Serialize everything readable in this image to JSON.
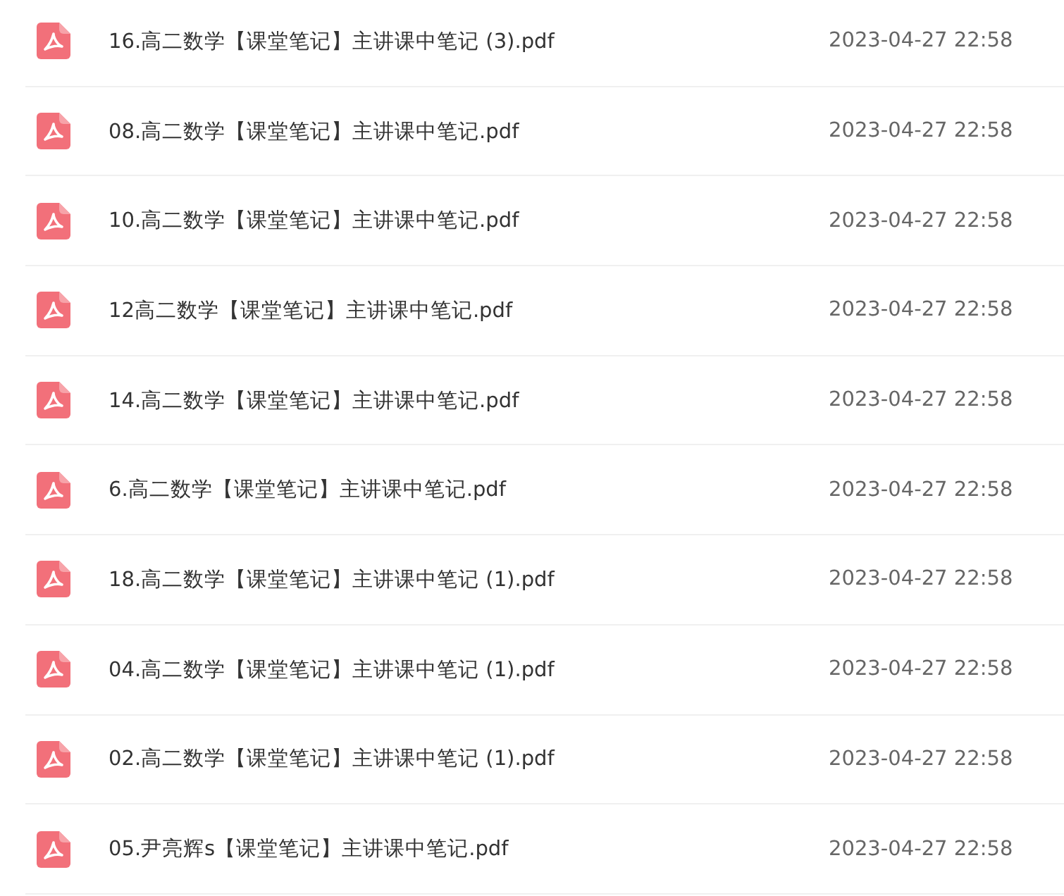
{
  "files": [
    {
      "name": "16.高二数学【课堂笔记】主讲课中笔记 (3).pdf",
      "date": "2023-04-27 22:58"
    },
    {
      "name": "08.高二数学【课堂笔记】主讲课中笔记.pdf",
      "date": "2023-04-27 22:58"
    },
    {
      "name": "10.高二数学【课堂笔记】主讲课中笔记.pdf",
      "date": "2023-04-27 22:58"
    },
    {
      "name": "12高二数学【课堂笔记】主讲课中笔记.pdf",
      "date": "2023-04-27 22:58"
    },
    {
      "name": "14.高二数学【课堂笔记】主讲课中笔记.pdf",
      "date": "2023-04-27 22:58"
    },
    {
      "name": "6.高二数学【课堂笔记】主讲课中笔记.pdf",
      "date": "2023-04-27 22:58"
    },
    {
      "name": "18.高二数学【课堂笔记】主讲课中笔记 (1).pdf",
      "date": "2023-04-27 22:58"
    },
    {
      "name": "04.高二数学【课堂笔记】主讲课中笔记 (1).pdf",
      "date": "2023-04-27 22:58"
    },
    {
      "name": "02.高二数学【课堂笔记】主讲课中笔记 (1).pdf",
      "date": "2023-04-27 22:58"
    },
    {
      "name": "05.尹亮辉s【课堂笔记】主讲课中笔记.pdf",
      "date": "2023-04-27 22:58"
    }
  ]
}
